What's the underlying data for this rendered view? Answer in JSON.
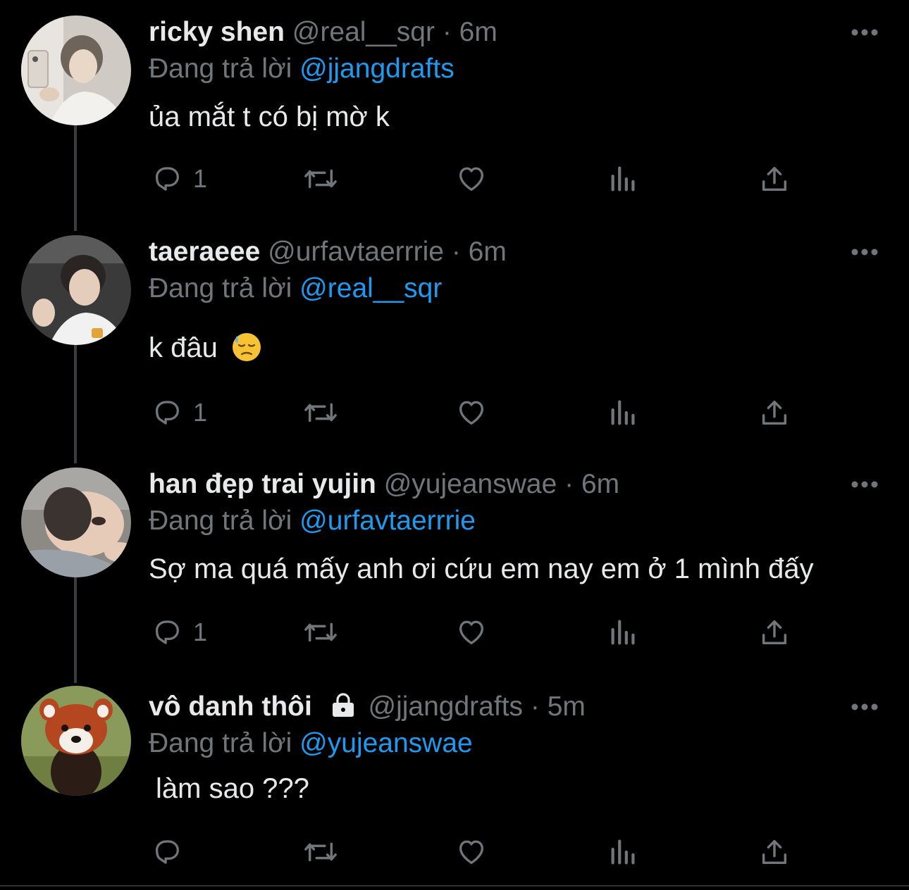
{
  "reply_prefix": "Đang trả lời",
  "colors": {
    "background": "#000000",
    "text": "#e7e9ea",
    "muted": "#71767b",
    "mention": "#1d9bf0"
  },
  "tweets": [
    {
      "name": "ricky shen",
      "handle": "@real__sqr",
      "separator": "·",
      "time": "6m",
      "reply_to": "@jjangdrafts",
      "text": "ủa mắt t có bị mờ k",
      "reply_count": "1",
      "avatar_icon": "avatar-photo-mirror-selfie",
      "locked": false
    },
    {
      "name": "taeraeee",
      "handle": "@urfavtaerrrie",
      "separator": "·",
      "time": "6m",
      "reply_to": "@real__sqr",
      "text": "k đâu",
      "emoji": "downcast-face-with-sweat-emoji",
      "reply_count": "1",
      "avatar_icon": "avatar-photo-boy-waving",
      "locked": false
    },
    {
      "name": "han đẹp trai yujin",
      "handle": "@yujeanswae",
      "separator": "·",
      "time": "6m",
      "reply_to": "@urfavtaerrrie",
      "text": "Sợ ma quá mấy anh ơi cứu em nay em ở 1 mình đấy",
      "reply_count": "1",
      "avatar_icon": "avatar-photo-face-closeup",
      "locked": false
    },
    {
      "name": "vô danh thôi",
      "handle": "@jjangdrafts",
      "separator": "·",
      "time": "5m",
      "reply_to": "@yujeanswae",
      "text": "làm sao ???",
      "reply_count": "",
      "avatar_icon": "avatar-photo-red-panda",
      "locked": true,
      "lock_icon": "lock-icon"
    }
  ]
}
